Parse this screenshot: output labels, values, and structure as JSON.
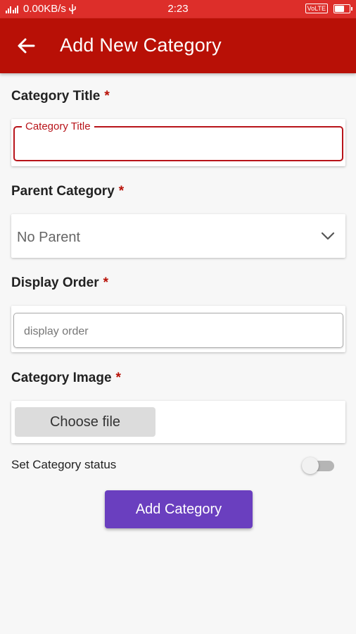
{
  "status_bar": {
    "network": "0.00KB/s",
    "time": "2:23",
    "volte": "VoLTE"
  },
  "app_bar": {
    "title": "Add New Category",
    "back_icon": "arrow-left-icon"
  },
  "form": {
    "category_title": {
      "label": "Category Title",
      "required": "*",
      "floating_label": "Category Title",
      "value": ""
    },
    "parent_category": {
      "label": "Parent Category",
      "required": "*",
      "selected": "No Parent",
      "icon": "chevron-down-icon"
    },
    "display_order": {
      "label": "Display Order",
      "required": "*",
      "placeholder": "display order",
      "value": ""
    },
    "category_image": {
      "label": "Category Image",
      "required": "*",
      "button_label": "Choose file"
    },
    "status": {
      "label": "Set Category status",
      "enabled": false
    },
    "submit_label": "Add Category"
  },
  "colors": {
    "status_bar": "#dd2e2a",
    "app_bar": "#b81006",
    "accent": "#b8141a",
    "button": "#6a3fbf"
  }
}
